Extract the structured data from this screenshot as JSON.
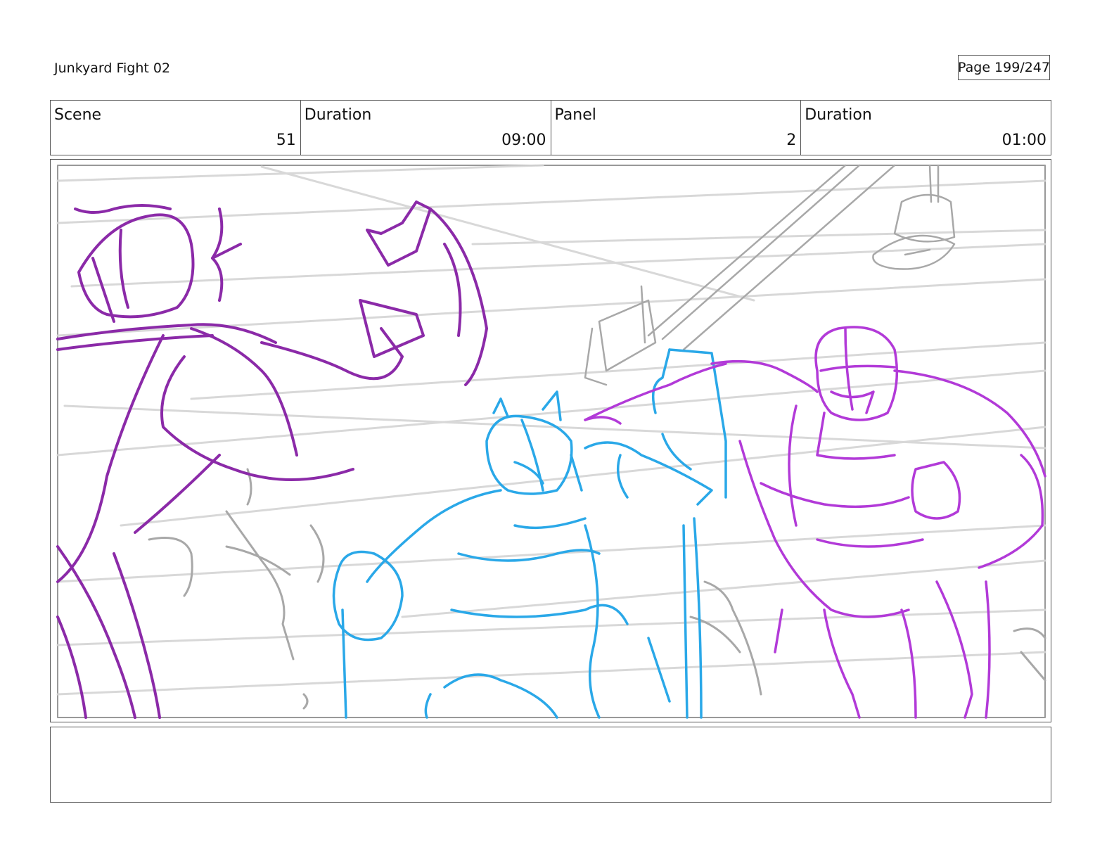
{
  "header": {
    "title": "Junkyard Fight 02",
    "page_label": "Page 199/247"
  },
  "info": {
    "scene_label": "Scene",
    "scene_value": "51",
    "scene_duration_label": "Duration",
    "scene_duration_value": "09:00",
    "panel_label": "Panel",
    "panel_value": "2",
    "panel_duration_label": "Duration",
    "panel_duration_value": "01:00"
  },
  "notes": {
    "text": ""
  },
  "colors": {
    "background_lines": "#c8c8c8",
    "left_character": "#8b2aa8",
    "center_character": "#2aa8e8",
    "right_character": "#b23ad8",
    "border": "#555555"
  },
  "icons": []
}
